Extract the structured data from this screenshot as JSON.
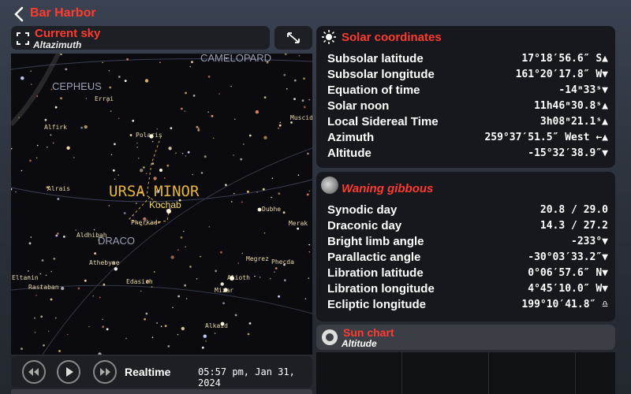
{
  "nav": {
    "back_title": "Bar Harbor"
  },
  "sky_header": {
    "title": "Current sky",
    "subtitle": "Altazimuth"
  },
  "sky": {
    "constellations": [
      "CAMELOPARD",
      "CEPHEUS",
      "URSA MINOR",
      "DRACO"
    ],
    "stars": [
      "Errai",
      "Alfirk",
      "Polaris",
      "Alrais",
      "Kochab",
      "Pherkad",
      "Aldhibah",
      "Athebyne",
      "Eltanin",
      "Rastaban",
      "Edasich",
      "Muscida",
      "Dubhe",
      "Merak",
      "Megrez",
      "Phecda",
      "Alioth",
      "Mizar",
      "Alkaid"
    ]
  },
  "controls": {
    "rewind_icon": "rewind-icon",
    "play_icon": "play-icon",
    "forward_icon": "fast-forward-icon",
    "mode": "Realtime",
    "datetime": "05:57 pm, Jan 31, 2024"
  },
  "solar": {
    "title": "Solar coordinates",
    "rows": [
      {
        "label": "Subsolar latitude",
        "value": "17°18′56.6″ S▲"
      },
      {
        "label": "Subsolar longitude",
        "value": "161°20′17.8″ W▼"
      },
      {
        "label": "Equation of time",
        "value": "-14ᵐ33ˢ▼"
      },
      {
        "label": "Solar noon",
        "value": "11h46ᵐ30.8ˢ▲"
      },
      {
        "label": "Local Sidereal Time",
        "value": "3h08ᵐ21.1ˢ▲"
      },
      {
        "label": "Azimuth",
        "value": "259°37′51.5″ West ←▲"
      },
      {
        "label": "Altitude",
        "value": "-15°32′38.9″▼"
      }
    ]
  },
  "moon": {
    "title": "Waning gibbous",
    "rows": [
      {
        "label": "Synodic day",
        "value": "20.8 / 29.0"
      },
      {
        "label": "Draconic day",
        "value": "14.3 / 27.2"
      },
      {
        "label": "Bright limb angle",
        "value": "-233°▼"
      },
      {
        "label": "Parallactic angle",
        "value": "-30°03′33.2″▼"
      },
      {
        "label": "Libration latitude",
        "value": "0°06′57.6″ N▼"
      },
      {
        "label": "Libration longitude",
        "value": "4°45′10.0″ W▼"
      },
      {
        "label": "Ecliptic longitude",
        "value": "199°10′41.8″ ♎"
      }
    ]
  },
  "sun_chart": {
    "title": "Sun chart",
    "subtitle": "Altitude"
  },
  "colors": {
    "accent": "#ff3b30",
    "panel": "#16181d",
    "sky": "#0b0b0f",
    "constellation_label": "#e8b53a"
  }
}
